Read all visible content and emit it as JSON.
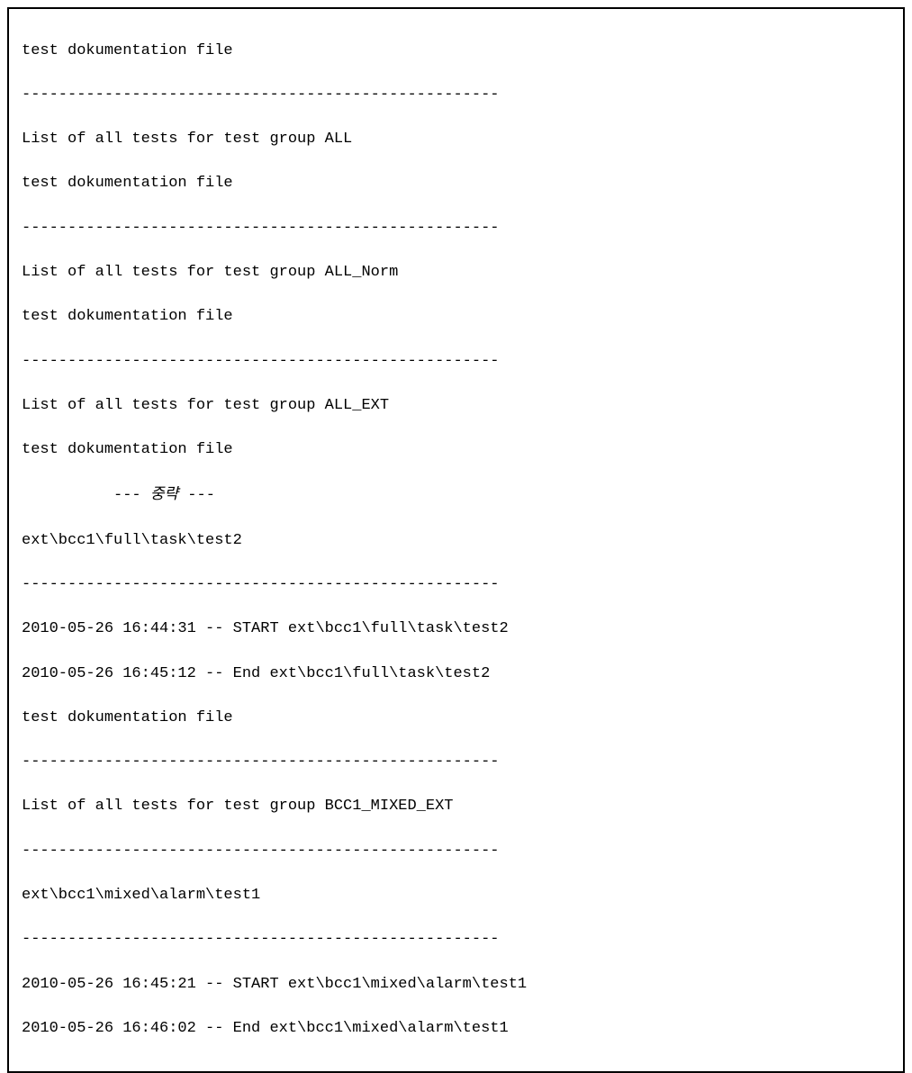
{
  "log": {
    "header1": "test dokumentation file",
    "sep_long": "----------------------------------------------------",
    "group_all": "List of all tests for test group ALL",
    "header2": "test dokumentation file",
    "group_all_norm": "List of all tests for test group ALL_Norm",
    "header3": "test dokumentation file",
    "group_all_ext": "List of all tests for test group ALL_EXT",
    "header4": "test dokumentation file",
    "omitted_prefix": "          --- ",
    "omitted_text": "중략",
    "omitted_suffix": " ---",
    "path_test2": "ext\\bcc1\\full\\task\\test2",
    "ts_start_test2": "2010-05-26 16:44:31 -- START ext\\bcc1\\full\\task\\test2",
    "ts_end_test2": "2010-05-26 16:45:12 -- End ext\\bcc1\\full\\task\\test2",
    "header5": "test dokumentation file",
    "group_bcc1_mixed": "List of all tests for test group BCC1_MIXED_EXT",
    "path_test1": "ext\\bcc1\\mixed\\alarm\\test1",
    "ts_start_test1": "2010-05-26 16:45:21 -- START ext\\bcc1\\mixed\\alarm\\test1",
    "ts_end_test1": "2010-05-26 16:46:02 -- End ext\\bcc1\\mixed\\alarm\\test1"
  }
}
